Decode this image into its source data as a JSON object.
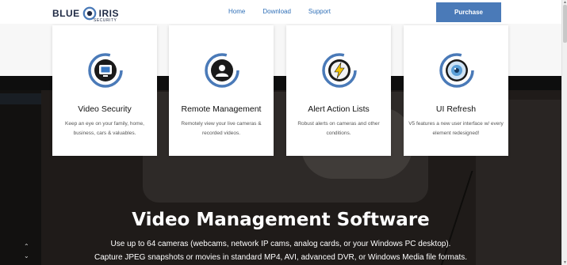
{
  "header": {
    "logo_left": "BLUE",
    "logo_right": "IRIS",
    "logo_sub": "SECURITY",
    "nav": [
      {
        "label": "Home"
      },
      {
        "label": "Download"
      },
      {
        "label": "Support"
      }
    ],
    "purchase_label": "Purchase"
  },
  "cards": [
    {
      "title": "Video Security",
      "desc": "Keep an eye on your family, home, business, cars & valuables.",
      "icon": "camera-monitor-icon"
    },
    {
      "title": "Remote Management",
      "desc": "Remotely view your live cameras & recorded videos.",
      "icon": "user-icon"
    },
    {
      "title": "Alert Action Lists",
      "desc": "Robust alerts on cameras and other conditions.",
      "icon": "lightning-icon"
    },
    {
      "title": "UI Refresh",
      "desc": "V5 features a new user interface w/ every element redesigned!",
      "icon": "eye-icon"
    }
  ],
  "hero": {
    "title": "Video Management Software",
    "line1": "Use up to 64 cameras (webcams, network IP cams, analog cards, or your Windows PC desktop).",
    "line2": "Capture JPEG snapshots or movies in standard MP4, AVI, advanced DVR, or Windows Media file formats."
  },
  "colors": {
    "accent": "#4a7ab8",
    "nav_link": "#2f6fb7",
    "brand_dark": "#1f2a44"
  }
}
